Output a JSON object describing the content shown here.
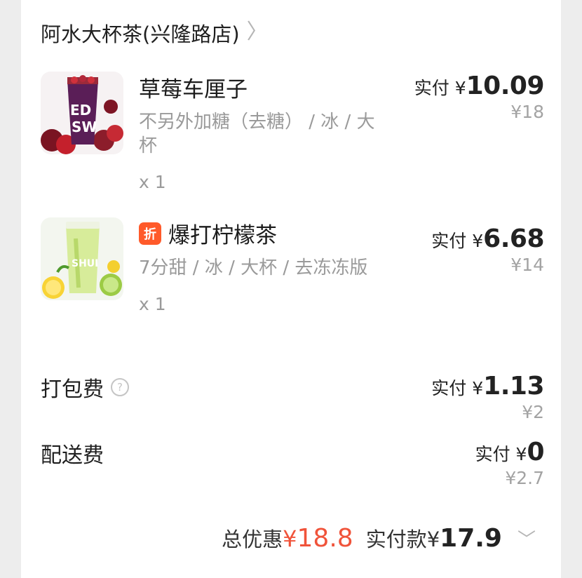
{
  "store": {
    "name": "阿水大杯茶(兴隆路店)",
    "chevron": "chevron-right-icon"
  },
  "items": [
    {
      "title": "草莓车厘子",
      "spec": "不另外加糖（去糖） / 冰 / 大杯",
      "qty": "x 1",
      "paid_label": "实付",
      "paid_currency": "¥",
      "paid_amount": "10.09",
      "original": "¥18"
    },
    {
      "badge": "折",
      "title": "爆打柠檬茶",
      "spec": "7分甜 / 冰 / 大杯 / 去冻冻版",
      "qty": "x 1",
      "paid_label": "实付",
      "paid_currency": "¥",
      "paid_amount": "6.68",
      "original": "¥14"
    }
  ],
  "fees": [
    {
      "label": "打包费",
      "paid_label": "实付",
      "paid_currency": "¥",
      "paid_amount": "1.13",
      "original": "¥2"
    },
    {
      "label": "配送费",
      "paid_label": "实付",
      "paid_currency": "¥",
      "paid_amount": "0",
      "original": "¥2.7"
    }
  ],
  "summary": {
    "discount_label": "总优惠",
    "discount_currency": "¥",
    "discount_amount": "18.8",
    "total_label": "实付款",
    "total_currency": "¥",
    "total_amount": "17.9"
  },
  "colors": {
    "accent_red": "#f0533a",
    "badge_orange": "#ff5a2a",
    "muted": "#9a9a9a"
  }
}
